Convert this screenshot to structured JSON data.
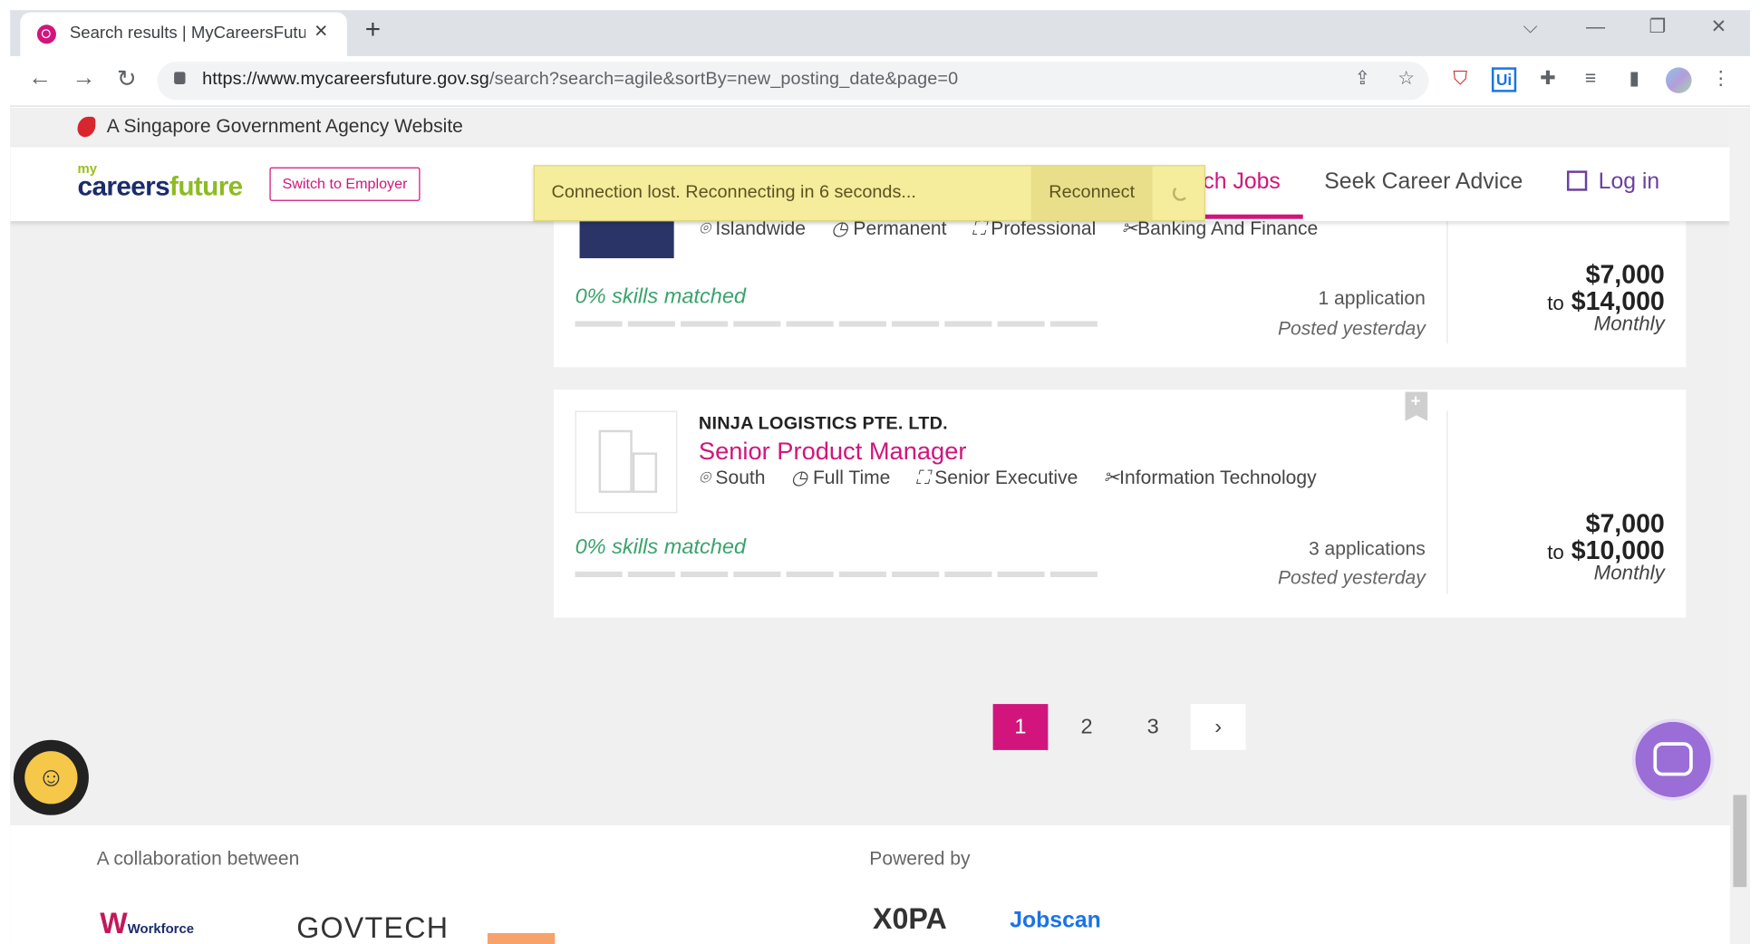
{
  "browser": {
    "tab_title": "Search results | MyCareersFuture",
    "url_host": "https://www.mycareersfuture.gov.sg",
    "url_path": "/search?search=agile&sortBy=new_posting_date&page=0"
  },
  "govbar": {
    "text": "A Singapore Government Agency Website"
  },
  "header": {
    "logo_my": "my",
    "logo_careers": "careers",
    "logo_future": "future",
    "switch_label": "Switch to Employer",
    "nav_search": "ch Jobs",
    "nav_advice": "Seek Career Advice",
    "nav_login": "Log in"
  },
  "toast": {
    "message": "Connection lost. Reconnecting in 6 seconds...",
    "button": "Reconnect"
  },
  "jobs": [
    {
      "location": "Islandwide",
      "type": "Permanent",
      "level": "Professional",
      "category": "Banking And Finance",
      "skills": "0% skills matched",
      "applications": "1 application",
      "posted": "Posted yesterday",
      "salary_from": "$7,000",
      "salary_to_prefix": "to",
      "salary_to": "$14,000",
      "frequency": "Monthly"
    },
    {
      "company": "NINJA LOGISTICS PTE. LTD.",
      "title": "Senior Product Manager",
      "location": "South",
      "type": "Full Time",
      "level": "Senior Executive",
      "category": "Information Technology",
      "skills": "0% skills matched",
      "applications": "3 applications",
      "posted": "Posted yesterday",
      "salary_from": "$7,000",
      "salary_to_prefix": "to",
      "salary_to": "$10,000",
      "frequency": "Monthly"
    }
  ],
  "pagination": {
    "pages": [
      "1",
      "2",
      "3"
    ],
    "current": "1",
    "next": "›"
  },
  "footer": {
    "collab": "A collaboration between",
    "powered": "Powered by",
    "logo_wsg": "Workforce",
    "logo_govtech": "GOVTECH",
    "logo_xopa": "X0PA",
    "logo_jobscan": "Jobscan"
  },
  "colors": {
    "brand": "#d1157c",
    "skills": "#3aa36c",
    "toast": "#f5ec9c"
  }
}
